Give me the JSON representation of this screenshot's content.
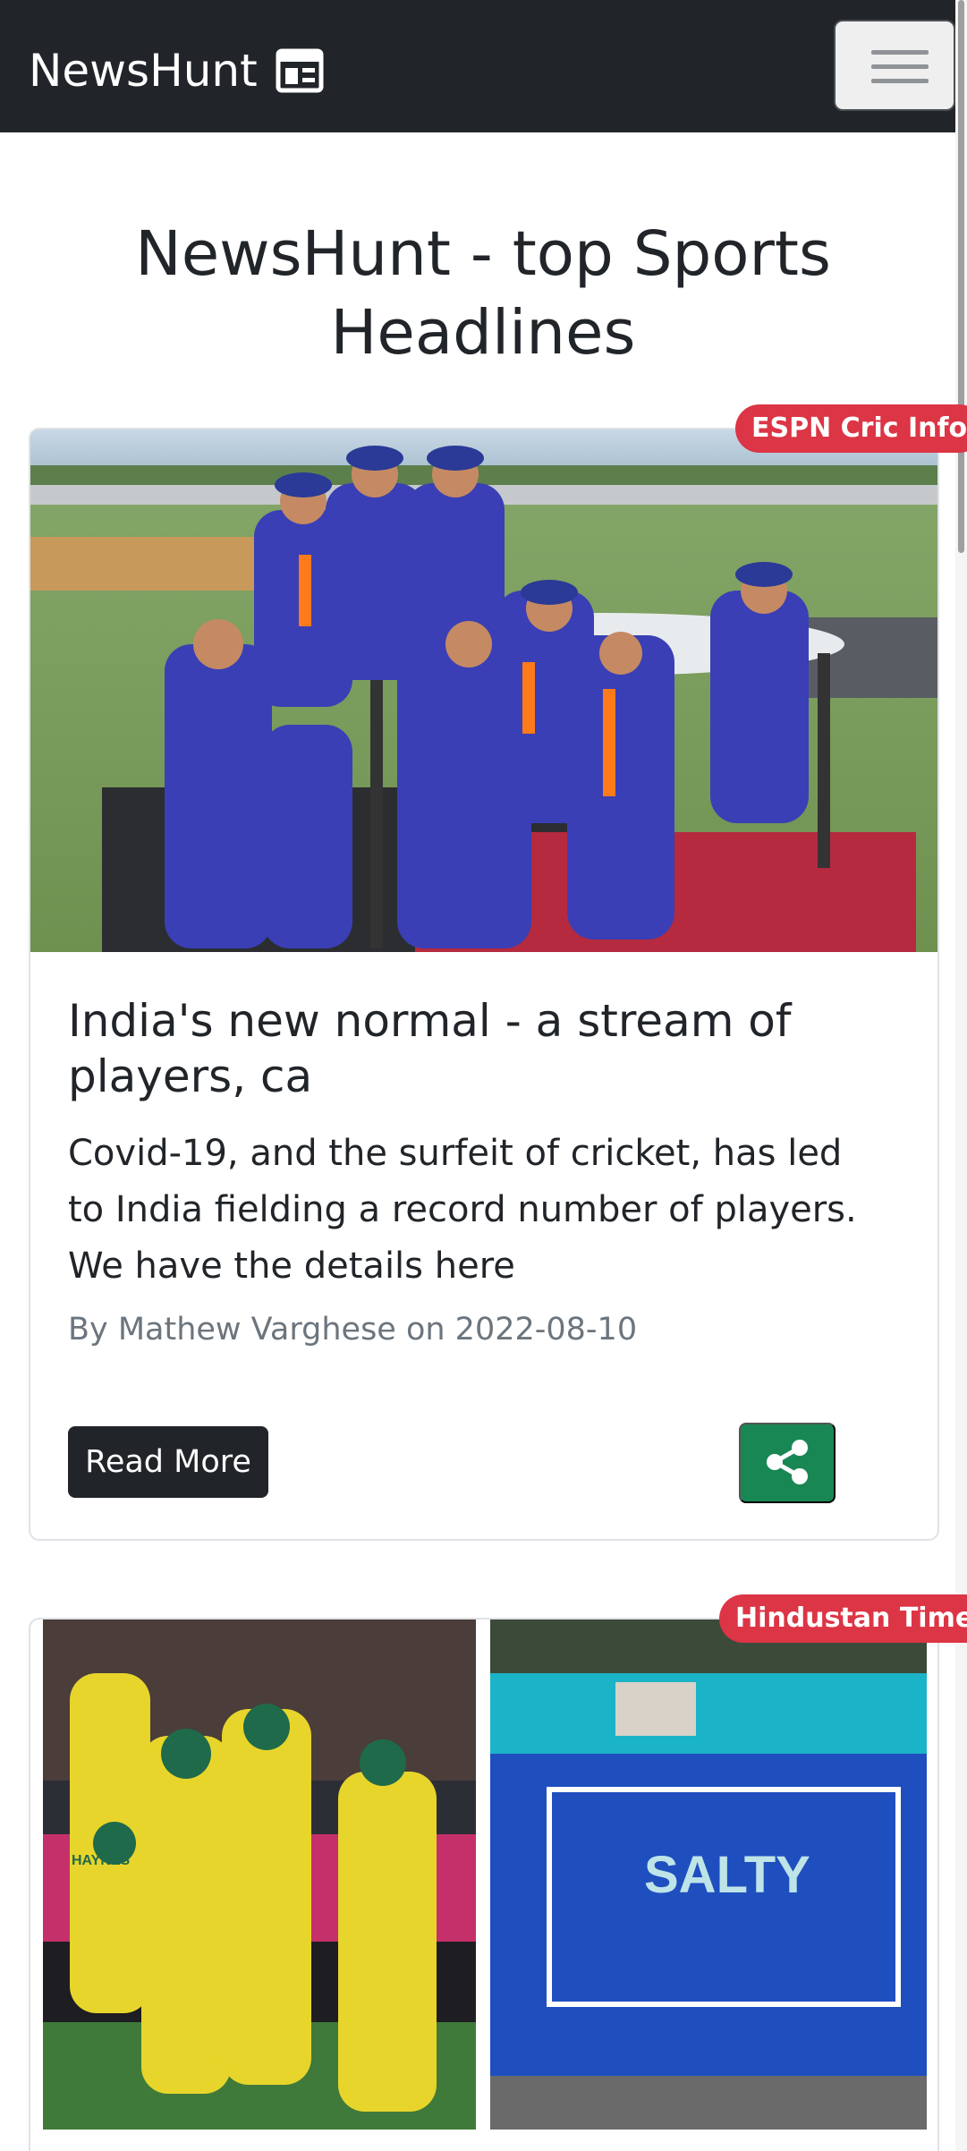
{
  "navbar": {
    "brand": "NewsHunt",
    "brand_icon": "newspaper-icon",
    "toggle_icon": "hamburger-menu-icon",
    "background": "#212529"
  },
  "page": {
    "title": "NewsHunt - top Sports Headlines"
  },
  "articles": [
    {
      "source": "ESPN Cric Info",
      "title": "India's new normal - a stream of players, ca",
      "description": "Covid-19, and the surfeit of cricket, has led to India fielding a record number of players. We have the details here",
      "meta": "By Mathew Varghese on 2022-08-10",
      "read_more_label": "Read More",
      "share_icon": "share-icon"
    },
    {
      "source": "Hindustan Times",
      "image_left_text": "HAYNES",
      "image_right_text": "SALTY"
    }
  ],
  "colors": {
    "badge": "#dc3545",
    "share_button": "#198754",
    "read_more_button": "#212529",
    "muted_text": "#6c757d"
  }
}
